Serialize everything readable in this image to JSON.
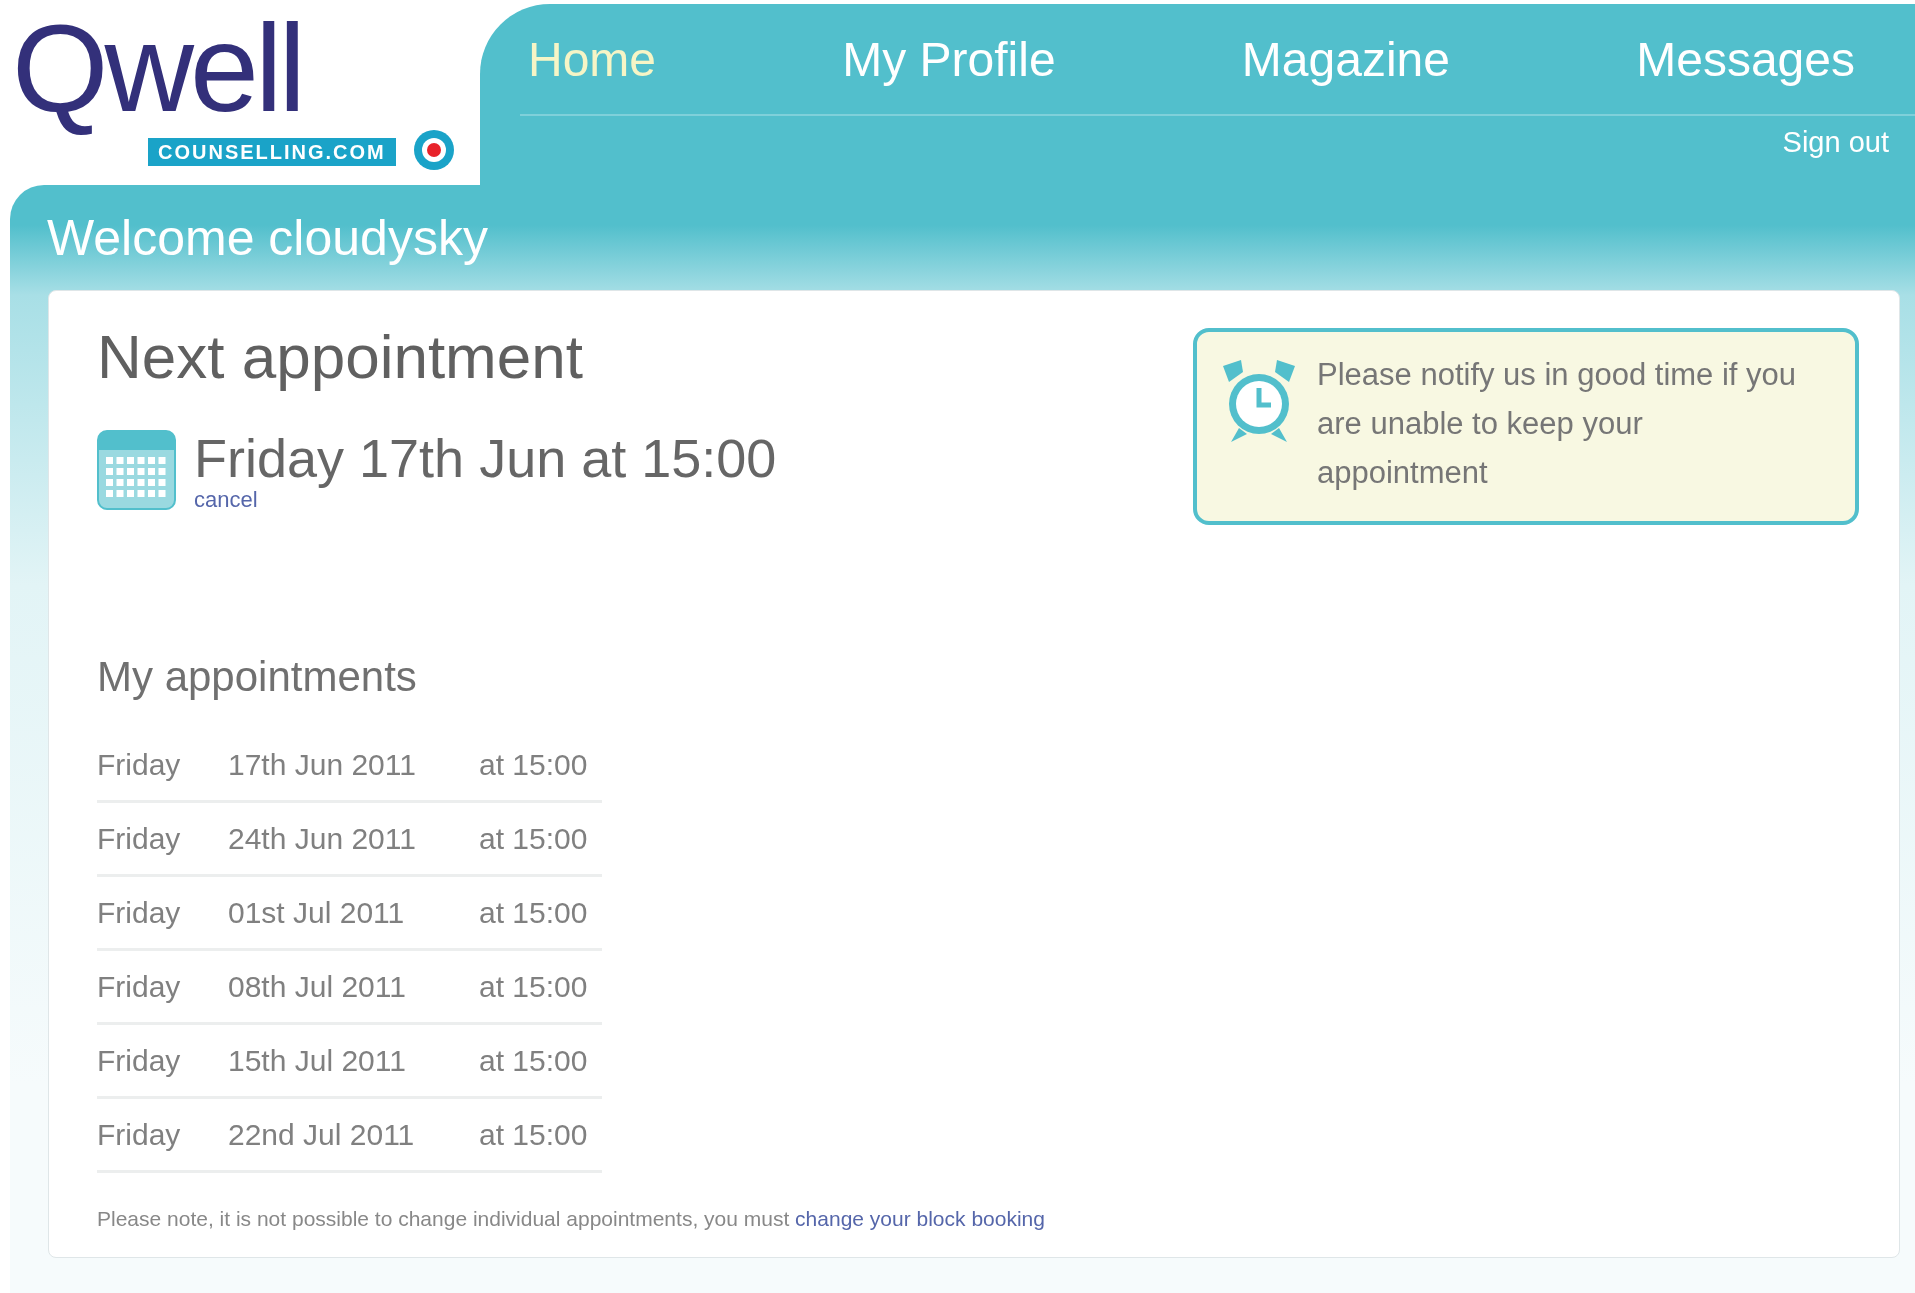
{
  "logo": {
    "wordmark": "Qwell",
    "tagline": "COUNSELLING.COM"
  },
  "nav": [
    {
      "label": "Home",
      "selected": true
    },
    {
      "label": "My Profile",
      "selected": false
    },
    {
      "label": "Magazine",
      "selected": false
    },
    {
      "label": "Messages",
      "selected": false
    }
  ],
  "sign_out": "Sign out",
  "welcome": "Welcome cloudysky",
  "next_appointment": {
    "title": "Next appointment",
    "date": "Friday 17th Jun at 15:00",
    "cancel": "cancel"
  },
  "notice": "Please notify us in good time if you are unable to keep your appointment",
  "appointments": {
    "title": "My appointments",
    "rows": [
      {
        "day": "Friday",
        "date": "17th Jun 2011",
        "time": "at 15:00"
      },
      {
        "day": "Friday",
        "date": "24th Jun 2011",
        "time": "at 15:00"
      },
      {
        "day": "Friday",
        "date": "01st Jul 2011",
        "time": "at 15:00"
      },
      {
        "day": "Friday",
        "date": "08th Jul 2011",
        "time": "at 15:00"
      },
      {
        "day": "Friday",
        "date": "15th Jul 2011",
        "time": "at 15:00"
      },
      {
        "day": "Friday",
        "date": "22nd Jul 2011",
        "time": "at 15:00"
      }
    ]
  },
  "footnote": {
    "text": "Please note, it is not possible to change individual appointments, you must",
    "link": "change your block booking"
  }
}
